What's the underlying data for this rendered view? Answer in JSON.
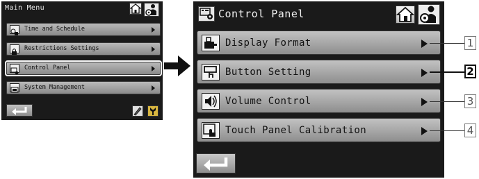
{
  "main_menu": {
    "title": "Main Menu",
    "items": [
      {
        "label": "Time and Schedule",
        "icon": "clock-calendar-icon",
        "selected": false
      },
      {
        "label": "Restrictions Settings",
        "icon": "lock-settings-icon",
        "selected": false
      },
      {
        "label": "Control Panel",
        "icon": "control-panel-icon",
        "selected": true
      },
      {
        "label": "System Management",
        "icon": "system-management-icon",
        "selected": false
      }
    ]
  },
  "control_panel": {
    "title": "Control Panel",
    "items": [
      {
        "label": "Display Format",
        "icon": "display-format-icon",
        "callout": "1",
        "highlighted": false
      },
      {
        "label": "Button Setting",
        "icon": "button-setting-icon",
        "callout": "2",
        "highlighted": true
      },
      {
        "label": "Volume Control",
        "icon": "volume-icon",
        "callout": "3",
        "highlighted": false
      },
      {
        "label": "Touch Panel Calibration",
        "icon": "touch-calibration-icon",
        "callout": "4",
        "highlighted": false
      }
    ]
  },
  "colors": {
    "screen_bg": "#1a1a1a",
    "button_gradient_top": "#c2c2c2",
    "button_gradient_bottom": "#8e8e8e",
    "tool_icon_yellow": "#d8b640"
  }
}
